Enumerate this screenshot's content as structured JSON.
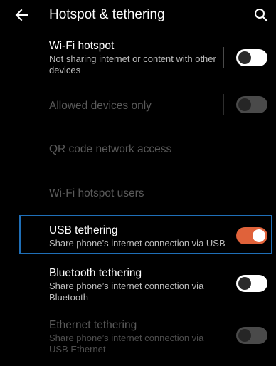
{
  "appbar": {
    "title": "Hotspot & tethering",
    "back_icon": "arrow-left-icon",
    "search_icon": "search-icon"
  },
  "items": {
    "wifi_hotspot": {
      "title": "Wi-Fi hotspot",
      "subtitle": "Not sharing internet or content with other devices",
      "toggle": "off",
      "enabled": true
    },
    "allowed_devices": {
      "title": "Allowed devices only",
      "toggle": "off",
      "enabled": false
    },
    "qr_code": {
      "title": "QR code network access",
      "enabled": false
    },
    "hotspot_users": {
      "title": "Wi-Fi hotspot users",
      "enabled": false
    },
    "usb_tethering": {
      "title": "USB tethering",
      "subtitle": "Share phone’s internet connection via USB",
      "toggle": "on",
      "enabled": true
    },
    "bluetooth_tethering": {
      "title": "Bluetooth tethering",
      "subtitle": "Share phone’s internet connection via Bluetooth",
      "toggle": "off",
      "enabled": true
    },
    "ethernet_tethering": {
      "title": "Ethernet tethering",
      "subtitle": "Share phone’s internet connection via USB Ethernet",
      "toggle": "off",
      "enabled": false
    }
  },
  "colors": {
    "background": "#000000",
    "accent_on": "#e0623a",
    "highlight_border": "#1f6fb8"
  }
}
